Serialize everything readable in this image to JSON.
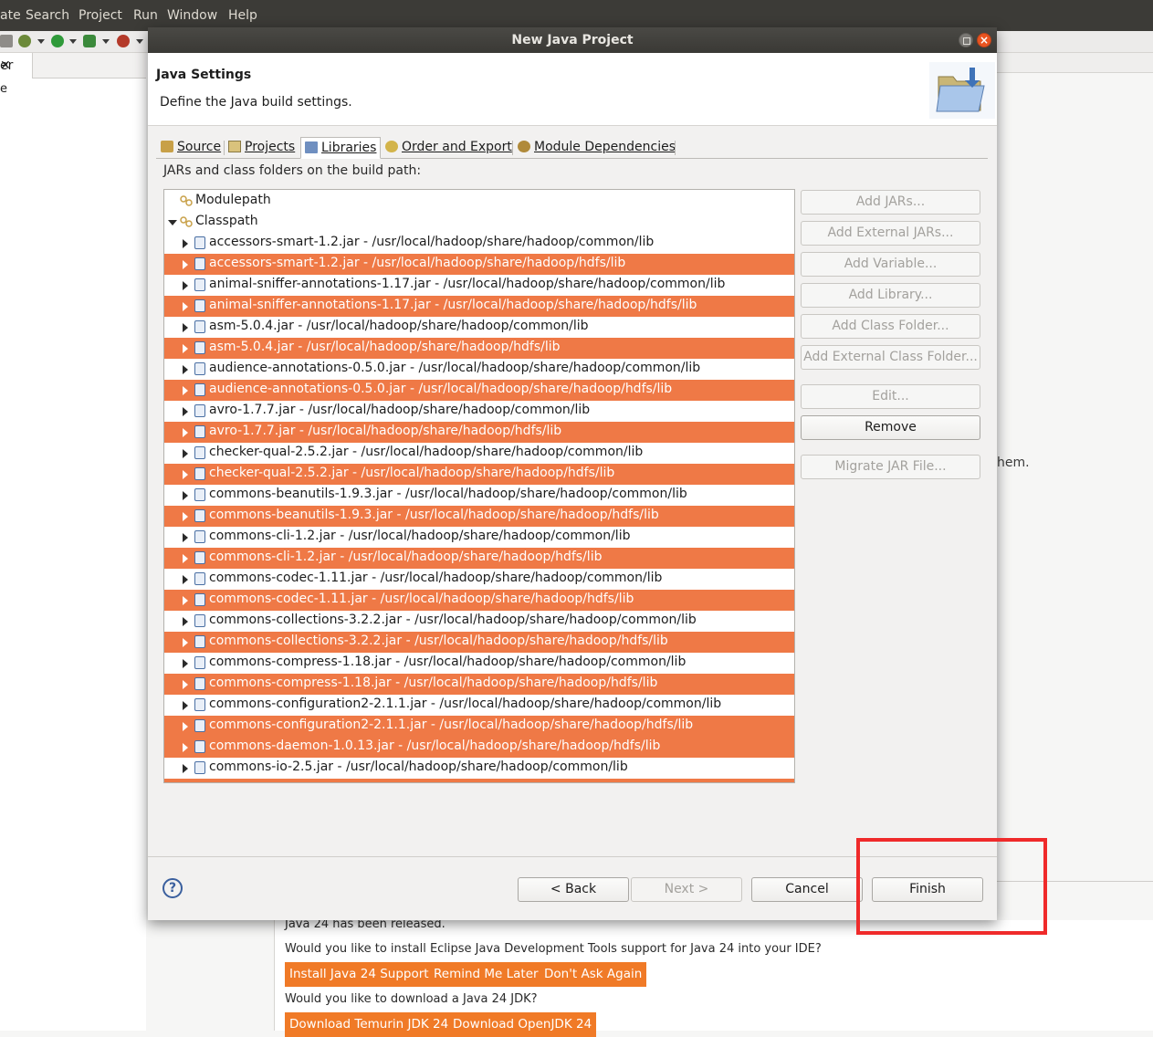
{
  "menubar": {
    "items": [
      "ate",
      "Search",
      "Project",
      "Run",
      "Window",
      "Help"
    ]
  },
  "left_panel": {
    "tab_label": "er",
    "close": "✕",
    "item": "e"
  },
  "background": {
    "partial_text": "hem."
  },
  "dialog": {
    "title": "New Java Project",
    "banner": {
      "heading": "Java Settings",
      "description": "Define the Java build settings."
    },
    "tabs": [
      "Source",
      "Projects",
      "Libraries",
      "Order and Export",
      "Module Dependencies"
    ],
    "active_tab": "Libraries",
    "list_label": "JARs and class folders on the build path:",
    "tree": {
      "modulepath": "Modulepath",
      "classpath": "Classpath",
      "entries": [
        {
          "text": "accessors-smart-1.2.jar - /usr/local/hadoop/share/hadoop/common/lib",
          "selected": false
        },
        {
          "text": "accessors-smart-1.2.jar - /usr/local/hadoop/share/hadoop/hdfs/lib",
          "selected": true
        },
        {
          "text": "animal-sniffer-annotations-1.17.jar - /usr/local/hadoop/share/hadoop/common/lib",
          "selected": false
        },
        {
          "text": "animal-sniffer-annotations-1.17.jar - /usr/local/hadoop/share/hadoop/hdfs/lib",
          "selected": true
        },
        {
          "text": "asm-5.0.4.jar - /usr/local/hadoop/share/hadoop/common/lib",
          "selected": false
        },
        {
          "text": "asm-5.0.4.jar - /usr/local/hadoop/share/hadoop/hdfs/lib",
          "selected": true
        },
        {
          "text": "audience-annotations-0.5.0.jar - /usr/local/hadoop/share/hadoop/common/lib",
          "selected": false
        },
        {
          "text": "audience-annotations-0.5.0.jar - /usr/local/hadoop/share/hadoop/hdfs/lib",
          "selected": true
        },
        {
          "text": "avro-1.7.7.jar - /usr/local/hadoop/share/hadoop/common/lib",
          "selected": false
        },
        {
          "text": "avro-1.7.7.jar - /usr/local/hadoop/share/hadoop/hdfs/lib",
          "selected": true
        },
        {
          "text": "checker-qual-2.5.2.jar - /usr/local/hadoop/share/hadoop/common/lib",
          "selected": false
        },
        {
          "text": "checker-qual-2.5.2.jar - /usr/local/hadoop/share/hadoop/hdfs/lib",
          "selected": true
        },
        {
          "text": "commons-beanutils-1.9.3.jar - /usr/local/hadoop/share/hadoop/common/lib",
          "selected": false
        },
        {
          "text": "commons-beanutils-1.9.3.jar - /usr/local/hadoop/share/hadoop/hdfs/lib",
          "selected": true
        },
        {
          "text": "commons-cli-1.2.jar - /usr/local/hadoop/share/hadoop/common/lib",
          "selected": false
        },
        {
          "text": "commons-cli-1.2.jar - /usr/local/hadoop/share/hadoop/hdfs/lib",
          "selected": true
        },
        {
          "text": "commons-codec-1.11.jar - /usr/local/hadoop/share/hadoop/common/lib",
          "selected": false
        },
        {
          "text": "commons-codec-1.11.jar - /usr/local/hadoop/share/hadoop/hdfs/lib",
          "selected": true
        },
        {
          "text": "commons-collections-3.2.2.jar - /usr/local/hadoop/share/hadoop/common/lib",
          "selected": false
        },
        {
          "text": "commons-collections-3.2.2.jar - /usr/local/hadoop/share/hadoop/hdfs/lib",
          "selected": true
        },
        {
          "text": "commons-compress-1.18.jar - /usr/local/hadoop/share/hadoop/common/lib",
          "selected": false
        },
        {
          "text": "commons-compress-1.18.jar - /usr/local/hadoop/share/hadoop/hdfs/lib",
          "selected": true
        },
        {
          "text": "commons-configuration2-2.1.1.jar - /usr/local/hadoop/share/hadoop/common/lib",
          "selected": false
        },
        {
          "text": "commons-configuration2-2.1.1.jar - /usr/local/hadoop/share/hadoop/hdfs/lib",
          "selected": true
        },
        {
          "text": "commons-daemon-1.0.13.jar - /usr/local/hadoop/share/hadoop/hdfs/lib",
          "selected": true
        },
        {
          "text": "commons-io-2.5.jar - /usr/local/hadoop/share/hadoop/common/lib",
          "selected": false
        }
      ]
    },
    "side_buttons": {
      "add_jars": "Add JARs...",
      "add_external_jars": "Add External JARs...",
      "add_variable": "Add Variable...",
      "add_library": "Add Library...",
      "add_class_folder": "Add Class Folder...",
      "add_external_class_folder": "Add External Class Folder...",
      "edit": "Edit...",
      "remove": "Remove",
      "migrate_jar": "Migrate JAR File..."
    },
    "footer": {
      "help": "?",
      "back": "< Back",
      "next": "Next >",
      "cancel": "Cancel",
      "finish": "Finish"
    }
  },
  "notification": {
    "line1": "Java 24 has been released.",
    "line2": "Would you like to install Eclipse Java Development Tools support for Java 24 into your IDE?",
    "btn_install": "Install Java 24 Support",
    "btn_remind": "Remind Me Later",
    "btn_dont_ask": "Don't Ask Again",
    "line3": "Would you like to download a Java 24 JDK?",
    "btn_temurin": "Download Temurin JDK 24",
    "btn_openjdk": "Download OpenJDK 24"
  },
  "colors": {
    "selection": "#ef7946",
    "accent": "#f07a27",
    "highlight_box": "#ef2a2a"
  }
}
